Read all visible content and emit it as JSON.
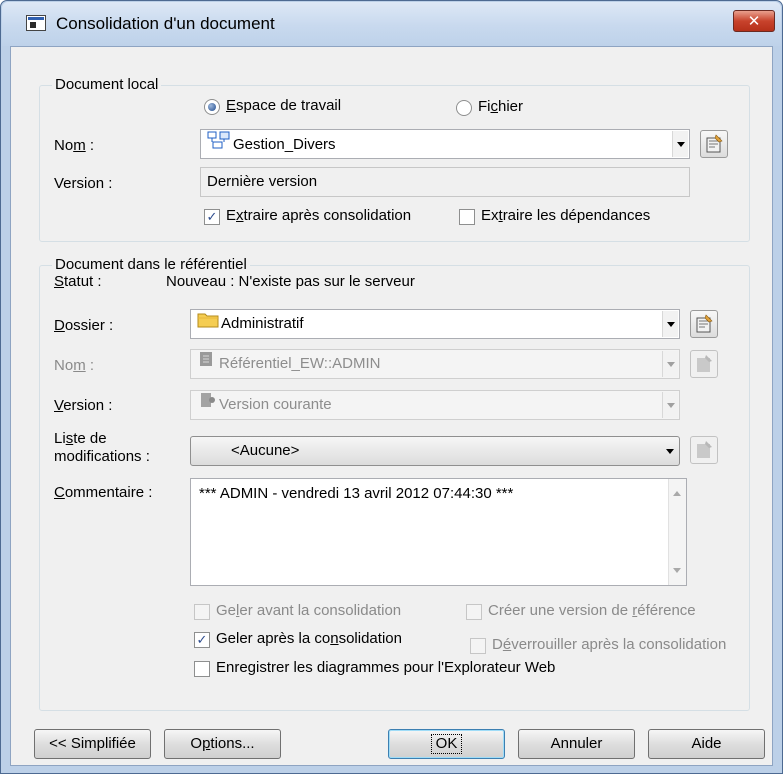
{
  "window": {
    "title": "Consolidation d'un document",
    "close_glyph": "✕"
  },
  "local": {
    "legend": "Document local",
    "radio_workspace": "Espace de travail",
    "radio_file": "Fichier",
    "name_label": "Nom :",
    "name_value": "Gestion_Divers",
    "version_label": "Version :",
    "version_value": "Dernière version",
    "check_extract_after": "Extraire après consolidation",
    "check_extract_deps": "Extraire les dépendances"
  },
  "repo": {
    "legend": "Document dans le référentiel",
    "status_label": "Statut :",
    "status_value": "Nouveau : N'existe pas sur le serveur",
    "folder_label": "Dossier :",
    "folder_value": "Administratif",
    "name_label": "Nom :",
    "name_value": "Référentiel_EW::ADMIN",
    "version_label": "Version :",
    "version_value": "Version courante",
    "changelist_label_1": "Liste de",
    "changelist_label_2": "modifications :",
    "changelist_value": "<Aucune>",
    "comment_label": "Commentaire :",
    "comment_value": "*** ADMIN - vendredi 13 avril 2012 07:44:30 ***",
    "check_freeze_before": "Geler avant la consolidation",
    "check_create_ref": "Créer une version de référence",
    "check_freeze_after": "Geler après la consolidation",
    "check_unlock_after": "Déverrouiller après la consolidation",
    "check_save_diagrams": "Enregistrer les diagrammes pour l'Explorateur Web"
  },
  "buttons": {
    "simplified": "<< Simplifiée",
    "options": "Options...",
    "ok": "OK",
    "cancel": "Annuler",
    "help": "Aide"
  },
  "state": {
    "workspace_selected": true,
    "extract_after_checked": true,
    "extract_deps_checked": false,
    "freeze_before_checked": false,
    "create_ref_checked": false,
    "freeze_after_checked": true,
    "unlock_after_checked": false,
    "save_diagrams_checked": false
  },
  "colors": {
    "window_frame": "#bcd0e8",
    "client_bg": "#f0f0f0",
    "close_button": "#c8432c",
    "check_mark": "#2d4c8e"
  },
  "icons": {
    "model": "model-icon",
    "folder": "folder-icon",
    "repository": "repository-icon",
    "version": "version-icon",
    "properties": "properties-icon"
  }
}
